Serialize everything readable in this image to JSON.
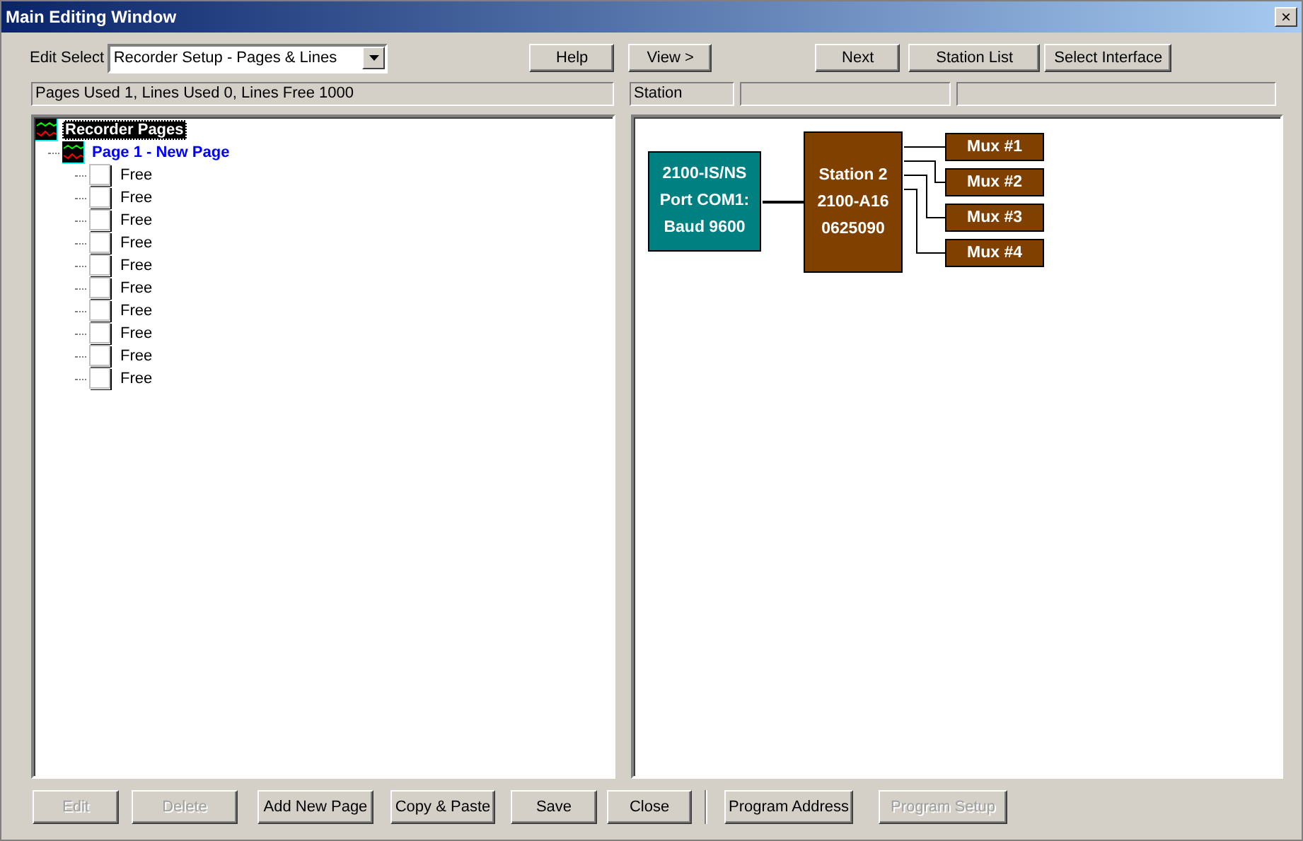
{
  "window": {
    "title": "Main Editing Window",
    "close": "×"
  },
  "toolbar": {
    "edit_select_label": "Edit Select",
    "edit_select_value": "Recorder Setup - Pages & Lines",
    "buttons": [
      {
        "label": "Help"
      },
      {
        "label": "View >"
      },
      {
        "label": "Next"
      },
      {
        "label": "Station List"
      },
      {
        "label": "Select Interface"
      }
    ]
  },
  "status_left": "Pages Used 1, Lines Used 0, Lines Free 1000",
  "status_right": [
    "Station"
  ],
  "tree": [
    {
      "label": "Recorder Pages",
      "kind": "root",
      "selected": true,
      "children": [
        {
          "label": "Page 1 - New Page",
          "kind": "page",
          "selected": false,
          "children": [
            {
              "label": "Free",
              "kind": "line",
              "selected": false
            },
            {
              "label": "Free",
              "kind": "line",
              "selected": false
            },
            {
              "label": "Free",
              "kind": "line",
              "selected": false
            },
            {
              "label": "Free",
              "kind": "line",
              "selected": false
            },
            {
              "label": "Free",
              "kind": "line",
              "selected": false
            },
            {
              "label": "Free",
              "kind": "line",
              "selected": false
            },
            {
              "label": "Free",
              "kind": "line",
              "selected": false
            },
            {
              "label": "Free",
              "kind": "line",
              "selected": false
            },
            {
              "label": "Free",
              "kind": "line",
              "selected": false
            },
            {
              "label": "Free",
              "kind": "line",
              "selected": false
            }
          ]
        }
      ]
    }
  ],
  "diagram": {
    "interface": {
      "lines": [
        "2100-IS/NS",
        "Port COM1:",
        "Baud 9600"
      ],
      "color": "#008080"
    },
    "station": {
      "lines": [
        "Station 2",
        "2100-A16",
        "0625090"
      ],
      "color": "#804000"
    },
    "muxes": [
      {
        "label": "Mux #1",
        "color": "#804000"
      },
      {
        "label": "Mux #2",
        "color": "#804000"
      },
      {
        "label": "Mux #3",
        "color": "#804000"
      },
      {
        "label": "Mux #4",
        "color": "#804000"
      }
    ]
  },
  "bottom_buttons": [
    {
      "label": "Edit",
      "disabled": true
    },
    {
      "label": "Delete",
      "disabled": true
    },
    {
      "label": "Add New Page",
      "disabled": false
    },
    {
      "label": "Copy & Paste",
      "disabled": false
    },
    {
      "label": "Save",
      "disabled": false
    },
    {
      "label": "Close",
      "disabled": false,
      "separator_after": true
    },
    {
      "label": "Program Address",
      "disabled": false
    },
    {
      "label": "Program Setup",
      "disabled": true
    }
  ]
}
